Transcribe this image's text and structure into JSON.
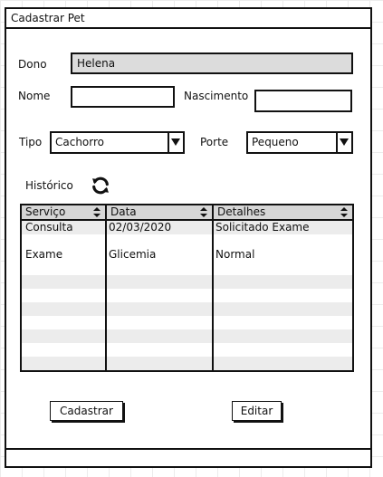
{
  "window": {
    "title": "Cadastrar Pet"
  },
  "form": {
    "owner_label": "Dono",
    "owner_value": "Helena",
    "name_label": "Nome",
    "name_value": "",
    "birth_label": "Nascimento",
    "birth_value": "",
    "type_label": "Tipo",
    "type_value": "Cachorro",
    "size_label": "Porte",
    "size_value": "Pequeno"
  },
  "history": {
    "label": "Histórico",
    "refresh_icon": "refresh-icon",
    "columns": [
      "Serviço",
      "Data",
      "Detalhes"
    ],
    "rows": [
      [
        "Consulta",
        "02/03/2020",
        "Solicitado Exame"
      ],
      [
        "Exame",
        "Glicemia",
        "Normal"
      ],
      [
        "",
        "",
        ""
      ],
      [
        "",
        "",
        ""
      ],
      [
        "",
        "",
        ""
      ],
      [
        "",
        "",
        ""
      ]
    ]
  },
  "buttons": {
    "register": "Cadastrar",
    "edit": "Editar"
  },
  "colors": {
    "disabled_field": "#dcdcdc",
    "header": "#d6d6d6",
    "alt_row": "#ececec"
  }
}
